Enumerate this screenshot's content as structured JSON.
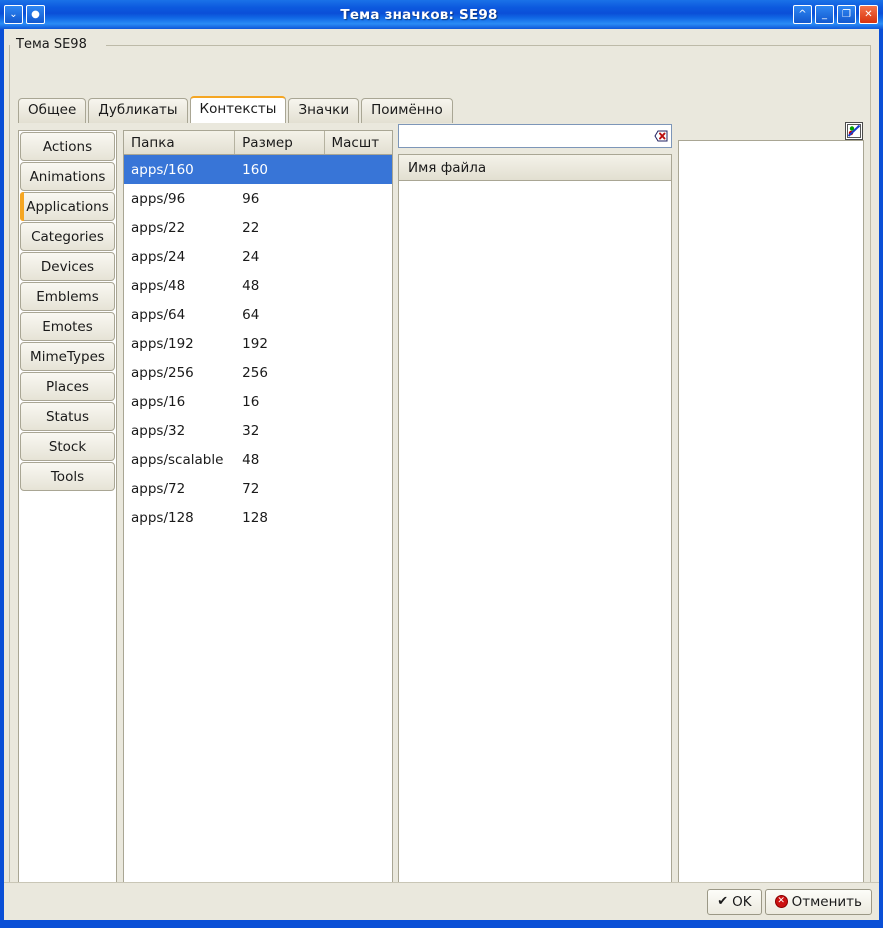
{
  "window": {
    "title": "Тема значков: SE98",
    "left_buttons": [
      {
        "name": "window-menu-button",
        "glyph": "⌄"
      },
      {
        "name": "window-shade-button",
        "glyph": "●"
      }
    ],
    "right_buttons": [
      {
        "name": "rollup-button",
        "glyph": "^"
      },
      {
        "name": "minimize-button",
        "glyph": "_"
      },
      {
        "name": "maximize-button",
        "glyph": "❐"
      },
      {
        "name": "close-button",
        "glyph": "✕"
      }
    ],
    "colors": {
      "titlebar_blue": "#0b4fd8",
      "client_bg": "#eae8dd",
      "selection_blue": "#3875d7",
      "accent_orange": "#f5a623",
      "close_red": "#d8320d"
    }
  },
  "groupbox": {
    "label": "Тема SE98"
  },
  "tabs": [
    {
      "label": "Общее",
      "active": false
    },
    {
      "label": "Дубликаты",
      "active": false
    },
    {
      "label": "Контексты",
      "active": true
    },
    {
      "label": "Значки",
      "active": false
    },
    {
      "label": "Поимённо",
      "active": false
    }
  ],
  "categories": [
    {
      "label": "Actions",
      "selected": false
    },
    {
      "label": "Animations",
      "selected": false
    },
    {
      "label": "Applications",
      "selected": true
    },
    {
      "label": "Categories",
      "selected": false
    },
    {
      "label": "Devices",
      "selected": false
    },
    {
      "label": "Emblems",
      "selected": false
    },
    {
      "label": "Emotes",
      "selected": false
    },
    {
      "label": "MimeTypes",
      "selected": false
    },
    {
      "label": "Places",
      "selected": false
    },
    {
      "label": "Status",
      "selected": false
    },
    {
      "label": "Stock",
      "selected": false
    },
    {
      "label": "Tools",
      "selected": false
    }
  ],
  "folder_table": {
    "columns": [
      "Папка",
      "Размер",
      "Масшт"
    ],
    "rows": [
      {
        "folder": "apps/160",
        "size": "160",
        "scale": "",
        "selected": true
      },
      {
        "folder": "apps/96",
        "size": "96",
        "scale": "",
        "selected": false
      },
      {
        "folder": "apps/22",
        "size": "22",
        "scale": "",
        "selected": false
      },
      {
        "folder": "apps/24",
        "size": "24",
        "scale": "",
        "selected": false
      },
      {
        "folder": "apps/48",
        "size": "48",
        "scale": "",
        "selected": false
      },
      {
        "folder": "apps/64",
        "size": "64",
        "scale": "",
        "selected": false
      },
      {
        "folder": "apps/192",
        "size": "192",
        "scale": "",
        "selected": false
      },
      {
        "folder": "apps/256",
        "size": "256",
        "scale": "",
        "selected": false
      },
      {
        "folder": "apps/16",
        "size": "16",
        "scale": "",
        "selected": false
      },
      {
        "folder": "apps/32",
        "size": "32",
        "scale": "",
        "selected": false
      },
      {
        "folder": "apps/scalable",
        "size": "48",
        "scale": "",
        "selected": false
      },
      {
        "folder": "apps/72",
        "size": "72",
        "scale": "",
        "selected": false
      },
      {
        "folder": "apps/128",
        "size": "128",
        "scale": "",
        "selected": false
      }
    ]
  },
  "file_panel": {
    "search": {
      "value": "",
      "placeholder": ""
    },
    "clear_icon": "clear-text-icon",
    "column_header": "Имя файла",
    "rows": []
  },
  "preview_panel": {
    "edit_icon": "edit-icon-button",
    "rows": []
  },
  "buttons": {
    "ok": "OK",
    "cancel": "Отменить"
  }
}
